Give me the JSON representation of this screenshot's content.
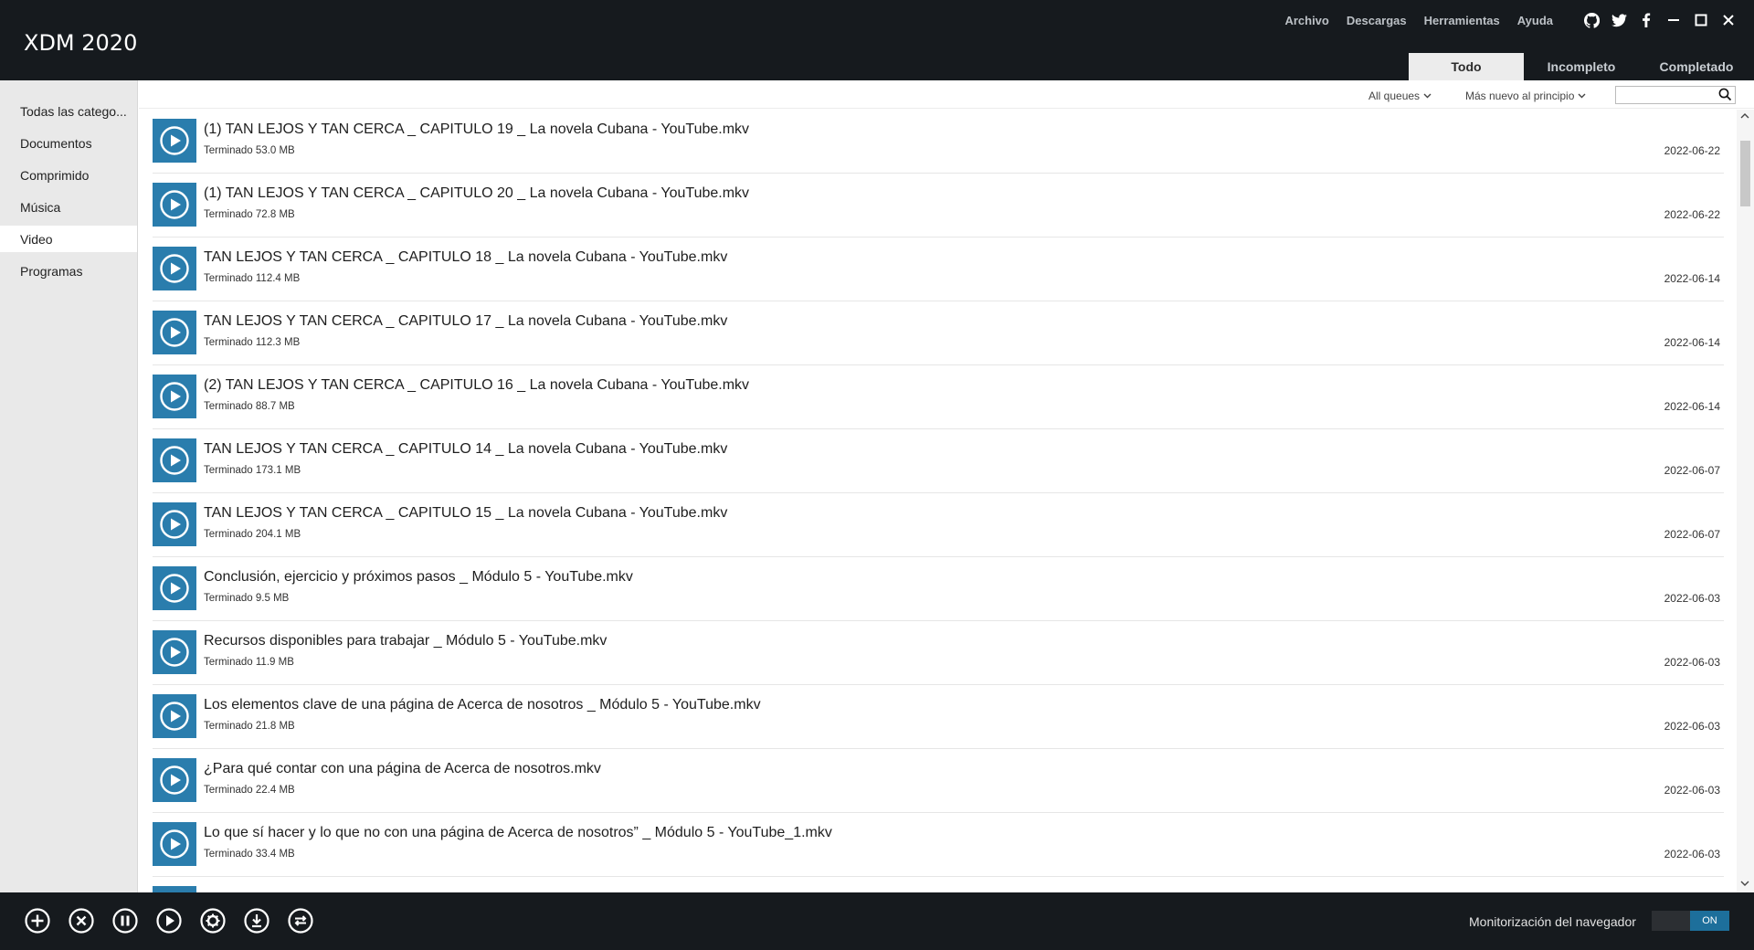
{
  "app": {
    "title": "XDM 2020"
  },
  "menu": [
    "Archivo",
    "Descargas",
    "Herramientas",
    "Ayuda"
  ],
  "window_icons": [
    "github-icon",
    "twitter-icon",
    "facebook-icon",
    "minimize-icon",
    "maximize-icon",
    "close-icon"
  ],
  "tabs": [
    {
      "label": "Todo",
      "active": true
    },
    {
      "label": "Incompleto",
      "active": false
    },
    {
      "label": "Completado",
      "active": false
    }
  ],
  "sidebar": {
    "items": [
      {
        "label": "Todas las catego...",
        "active": false
      },
      {
        "label": "Documentos",
        "active": false
      },
      {
        "label": "Comprimido",
        "active": false
      },
      {
        "label": "Música",
        "active": false
      },
      {
        "label": "Video",
        "active": true
      },
      {
        "label": "Programas",
        "active": false
      }
    ]
  },
  "toolbar": {
    "queue_filter": "All queues",
    "sort_order": "Más nuevo al principio",
    "search_placeholder": ""
  },
  "downloads": [
    {
      "name": "(1) TAN LEJOS Y TAN CERCA _ CAPITULO 19 _ La novela Cubana - YouTube.mkv",
      "status": "Terminado 53.0 MB",
      "date": "2022-06-22"
    },
    {
      "name": "(1) TAN LEJOS Y TAN CERCA _ CAPITULO 20 _ La novela Cubana - YouTube.mkv",
      "status": "Terminado 72.8 MB",
      "date": "2022-06-22"
    },
    {
      "name": "TAN LEJOS Y TAN CERCA _ CAPITULO 18 _ La novela Cubana - YouTube.mkv",
      "status": "Terminado 112.4 MB",
      "date": "2022-06-14"
    },
    {
      "name": "TAN LEJOS Y TAN CERCA _ CAPITULO 17 _ La novela Cubana - YouTube.mkv",
      "status": "Terminado 112.3 MB",
      "date": "2022-06-14"
    },
    {
      "name": "(2) TAN LEJOS Y TAN CERCA _ CAPITULO 16 _ La novela Cubana - YouTube.mkv",
      "status": "Terminado 88.7 MB",
      "date": "2022-06-14"
    },
    {
      "name": "TAN LEJOS Y TAN CERCA _ CAPITULO 14 _ La novela Cubana - YouTube.mkv",
      "status": "Terminado 173.1 MB",
      "date": "2022-06-07"
    },
    {
      "name": "TAN LEJOS Y TAN CERCA _ CAPITULO 15 _ La novela Cubana - YouTube.mkv",
      "status": "Terminado 204.1 MB",
      "date": "2022-06-07"
    },
    {
      "name": "Conclusión, ejercicio y próximos pasos _ Módulo 5 - YouTube.mkv",
      "status": "Terminado 9.5 MB",
      "date": "2022-06-03"
    },
    {
      "name": "Recursos disponibles para trabajar _ Módulo 5 - YouTube.mkv",
      "status": "Terminado 11.9 MB",
      "date": "2022-06-03"
    },
    {
      "name": "Los elementos clave de una página de Acerca de nosotros _ Módulo 5 - YouTube.mkv",
      "status": "Terminado 21.8 MB",
      "date": "2022-06-03"
    },
    {
      "name": "¿Para qué contar con una página de Acerca de nosotros.mkv",
      "status": "Terminado 22.4 MB",
      "date": "2022-06-03"
    },
    {
      "name": "Lo que sí hacer y lo que no con una página de Acerca de nosotros” _ Módulo 5 - YouTube_1.mkv",
      "status": "Terminado 33.4 MB",
      "date": "2022-06-03"
    }
  ],
  "footer": {
    "buttons": [
      "add-icon",
      "cancel-icon",
      "pause-icon",
      "resume-icon",
      "settings-icon",
      "download-icon",
      "refresh-icon"
    ],
    "monitor_label": "Monitorización del navegador",
    "toggle_label": "ON"
  },
  "colors": {
    "accent": "#2a7dad",
    "dark_bg": "#161a1e",
    "sidebar_bg": "#e9e9e9"
  }
}
